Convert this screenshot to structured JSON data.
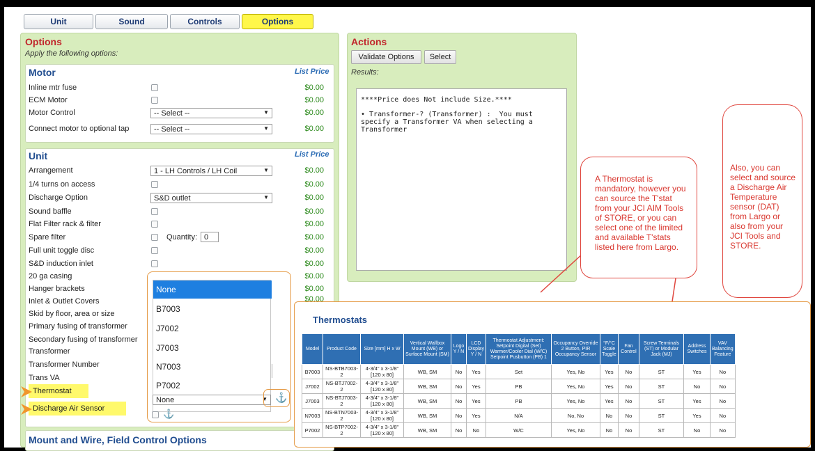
{
  "tabs": [
    "Unit",
    "Sound",
    "Controls",
    "Options"
  ],
  "options_panel": {
    "title": "Options",
    "subtitle": "Apply the following options:"
  },
  "motor": {
    "title": "Motor",
    "list_price": "List Price",
    "rows": [
      {
        "label": "Inline mtr fuse",
        "price": "$0.00"
      },
      {
        "label": "ECM Motor",
        "price": "$0.00"
      },
      {
        "label": "Motor Control",
        "price": "$0.00",
        "select": "-- Select --"
      },
      {
        "label": "Connect motor to optional tap",
        "price": "$0.00",
        "select": "-- Select --"
      }
    ]
  },
  "unit": {
    "title": "Unit",
    "list_price": "List Price",
    "quantity_label": "Quantity:",
    "quantity_value": "0",
    "rows": [
      {
        "label": "Arrangement",
        "price": "$0.00",
        "select": "1 - LH Controls / LH Coil"
      },
      {
        "label": "1/4 turns on access",
        "price": "$0.00"
      },
      {
        "label": "Discharge Option",
        "price": "$0.00",
        "select": "S&D outlet"
      },
      {
        "label": "Sound baffle",
        "price": "$0.00"
      },
      {
        "label": "Flat Filter rack & filter",
        "price": "$0.00"
      },
      {
        "label": "Spare filter",
        "price": "$0.00"
      },
      {
        "label": "Full unit toggle disc",
        "price": "$0.00"
      },
      {
        "label": "S&D induction inlet",
        "price": "$0.00"
      },
      {
        "label": "20 ga casing",
        "price": "$0.00"
      },
      {
        "label": "Hanger brackets",
        "price": "$0.00"
      },
      {
        "label": "Inlet & Outlet Covers",
        "price": "$0.00"
      },
      {
        "label": "Skid by floor, area or size"
      },
      {
        "label": "Primary fusing of transformer"
      },
      {
        "label": "Secondary fusing of transformer"
      },
      {
        "label": "Transformer"
      },
      {
        "label": "Transformer Number"
      },
      {
        "label": "Trans VA"
      },
      {
        "label": "Thermostat"
      },
      {
        "label": "Discharge Air Sensor"
      }
    ]
  },
  "thermostat_select": {
    "value": "None",
    "options": [
      "None",
      "B7003",
      "J7002",
      "J7003",
      "N7003",
      "P7002"
    ]
  },
  "mount_section": {
    "title": "Mount and Wire, Field Control Options"
  },
  "actions": {
    "title": "Actions",
    "validate_label": "Validate Options",
    "select_label": "Select",
    "results_label": "Results:",
    "results_line1": "****Price does Not include Size.****",
    "results_line2": "• Transformer-? (Transformer) :  You must specify a Transformer VA when selecting a Transformer"
  },
  "callouts": {
    "left": "A Thermostat is mandatory, however you can source the T'stat from your JCI AIM Tools of STORE, or you can select one of the limited and available T'stats listed here from Largo.",
    "right": "Also, you can select and source a Discharge Air Temperature sensor (DAT) from Largo or also from your JCI Tools and STORE."
  },
  "thermostats_table": {
    "title": "Thermostats",
    "columns": [
      "Model",
      "Product Code",
      "Size [mm] H x W",
      "Vertical Wallbox Mount (WB) or Surface Mount (SM)",
      "Logo Y / N",
      "LCD Display Y / N",
      "Thermostat Adjustment: Setpoint Digital (Set) Warmer/Cooler Dial (W/C) Setpoint Pusbutton (PB) 1",
      "Occupancy Override 2 Button, PIR Occupancy Sensor",
      "°F/°C Scale Toggle",
      "Fan Control",
      "Screw Terminals (ST) or Modular Jack (MJ)",
      "Address Switches",
      "VAV Balancing Feature"
    ],
    "rows": [
      [
        "B7003",
        "NS-BTB7003-2",
        "4-3/4\" x 3-1/8\" [120 x 80]",
        "WB, SM",
        "No",
        "Yes",
        "Set",
        "Yes, No",
        "Yes",
        "No",
        "ST",
        "Yes",
        "No"
      ],
      [
        "J7002",
        "NS-BTJ7002-2",
        "4-3/4\" x 3-1/8\" [120 x 80]",
        "WB, SM",
        "No",
        "Yes",
        "PB",
        "Yes, No",
        "Yes",
        "No",
        "ST",
        "No",
        "No"
      ],
      [
        "J7003",
        "NS-BTJ7003-2",
        "4-3/4\" x 3-1/8\" [120 x 80]",
        "WB, SM",
        "No",
        "Yes",
        "PB",
        "Yes, No",
        "Yes",
        "No",
        "ST",
        "Yes",
        "No"
      ],
      [
        "N7003",
        "NS-BTN7003-2",
        "4-3/4\" x 3-1/8\" [120 x 80]",
        "WB, SM",
        "No",
        "Yes",
        "N/A",
        "No, No",
        "No",
        "No",
        "ST",
        "Yes",
        "No"
      ],
      [
        "P7002",
        "NS-BTP7002-2",
        "4-3/4\" x 3-1/8\" [120 x 80]",
        "WB, SM",
        "No",
        "No",
        "W/C",
        "Yes, No",
        "No",
        "No",
        "ST",
        "No",
        "No"
      ]
    ]
  },
  "colors": {
    "accent_red": "#c1272d",
    "section_blue": "#1f4c8f",
    "price_green": "#2e8b1e",
    "highlight_yellow": "#fff96b",
    "callout_border": "#e0473f",
    "box_orange": "#e59a45"
  }
}
